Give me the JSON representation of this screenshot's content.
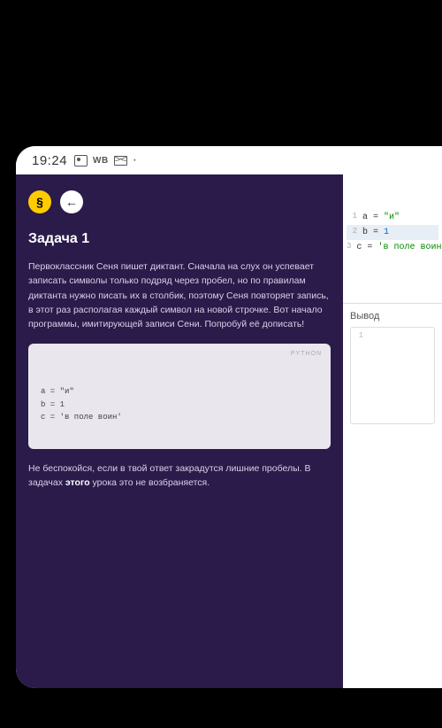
{
  "statusbar": {
    "time": "19:24",
    "wb_label": "WB"
  },
  "header": {
    "logo_glyph": "§",
    "back_glyph": "←"
  },
  "task": {
    "title": "Задача 1",
    "description": "Первоклассник Сеня пишет диктант. Сначала на слух он успевает записать символы только подряд через пробел, но по правилам диктанта нужно писать их в столбик, поэтому Сеня повторяет запись, в этот раз располагая каждый символ на новой строчке. Вот начало программы, имитирующей записи Сени. Попробуй её дописать!",
    "code_lang": "PYTHON",
    "code_lines": {
      "l1": "a = \"и\"",
      "l2": "b = 1",
      "l3": "c = 'в поле воин'"
    },
    "note_before": "Не беспокойся, если в твой ответ закрадутся лишние пробелы. В задачах ",
    "note_bold": "этого",
    "note_after": " урока это не возбраняется."
  },
  "editor": {
    "lines": [
      {
        "lineno": "1",
        "var": "a",
        "op": " = ",
        "val": "\"и\"",
        "cls": "tok-str"
      },
      {
        "lineno": "2",
        "var": "b",
        "op": " = ",
        "val": "1",
        "cls": "tok-num"
      },
      {
        "lineno": "3",
        "var": "c",
        "op": " = ",
        "val": "'в поле воин'",
        "cls": "tok-str"
      }
    ]
  },
  "output": {
    "label": "Вывод",
    "gutter": "1"
  }
}
